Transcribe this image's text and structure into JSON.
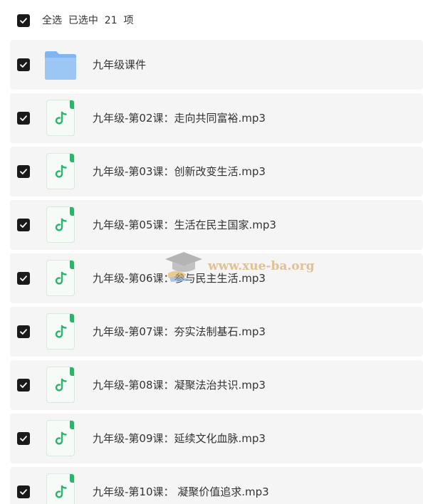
{
  "header": {
    "select_all_label": "全选  已选中  21  项",
    "select_all_checked": true
  },
  "files": [
    {
      "name": "九年级课件",
      "type": "folder",
      "checked": true
    },
    {
      "name": "九年级-第02课：走向共同富裕.mp3",
      "type": "audio",
      "checked": true
    },
    {
      "name": "九年级-第03课：创新改变生活.mp3",
      "type": "audio",
      "checked": true
    },
    {
      "name": "九年级-第05课：生活在民主国家.mp3",
      "type": "audio",
      "checked": true
    },
    {
      "name": "九年级-第06课：参与民主生活.mp3",
      "type": "audio",
      "checked": true
    },
    {
      "name": "九年级-第07课：夯实法制基石.mp3",
      "type": "audio",
      "checked": true
    },
    {
      "name": "九年级-第08课：凝聚法治共识.mp3",
      "type": "audio",
      "checked": true
    },
    {
      "name": "九年级-第09课：延续文化血脉.mp3",
      "type": "audio",
      "checked": true
    },
    {
      "name": "九年级-第10课： 凝聚价值追求.mp3",
      "type": "audio",
      "checked": true
    }
  ],
  "watermark": {
    "text": "www.xue-ba.org",
    "icon": "graduation-cap-icon"
  },
  "colors": {
    "row_bg": "#f5f5f6",
    "checkbox": "#1a1a1a",
    "audio_accent": "#2db36b",
    "folder": "#7fb5f0"
  }
}
